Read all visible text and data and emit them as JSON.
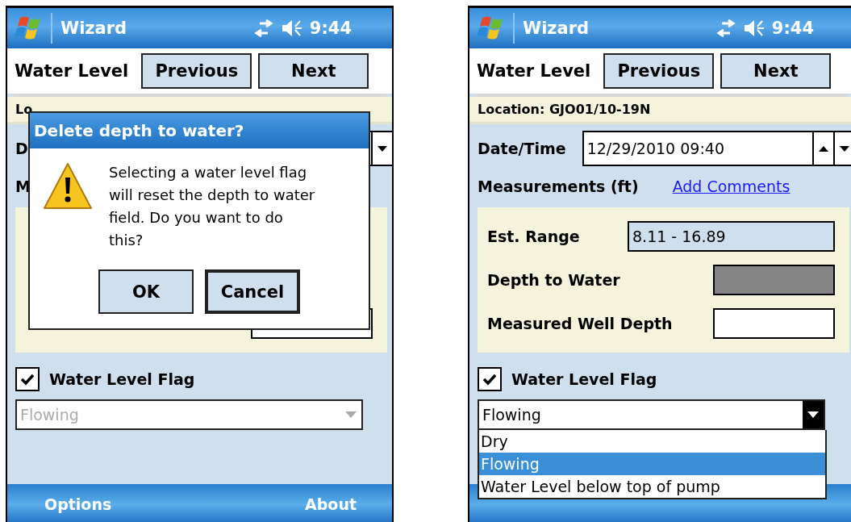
{
  "screens": [
    {
      "title": "Wizard",
      "time": "9:44",
      "heading": "Water Level",
      "buttons": [
        {
          "label": "Previous"
        },
        {
          "label": "Next"
        }
      ],
      "location": "Lo",
      "date": {
        "label": "D",
        "kind": "dropdown"
      },
      "measurements": {
        "label": "M",
        "rows": [
          {
            "kind": "input"
          }
        ]
      },
      "flag": {
        "label": "Water Level Flag",
        "checked": true,
        "value": "Flowing",
        "disabled": true,
        "expanded": false
      },
      "menu": [
        "Options",
        "About"
      ],
      "dialog": {
        "title": "Delete depth to water?",
        "message": "Selecting a water level flag will reset the depth to water field. Do you want to do this?",
        "buttons": [
          {
            "label": "OK",
            "default": false
          },
          {
            "label": "Cancel",
            "default": true
          }
        ]
      }
    },
    {
      "title": "Wizard",
      "time": "9:44",
      "heading": "Water Level",
      "buttons": [
        {
          "label": "Previous"
        },
        {
          "label": "Next"
        }
      ],
      "location": "Location: GJO01/10-19N",
      "date": {
        "label": "Date/Time",
        "value": "12/29/2010 09:40",
        "kind": "updown"
      },
      "measurements": {
        "label": "Measurements (ft)",
        "link": "Add Comments",
        "rows": [
          {
            "label": "Est. Range",
            "value": "8.11 - 16.89",
            "kind": "readonly"
          },
          {
            "label": "Depth to Water",
            "kind": "disabled"
          },
          {
            "label": "Measured Well Depth",
            "kind": "input"
          }
        ]
      },
      "flag": {
        "label": "Water Level Flag",
        "checked": true,
        "value": "Flowing",
        "disabled": false,
        "expanded": true,
        "options": [
          {
            "label": "Dry",
            "selected": false
          },
          {
            "label": "Flowing",
            "selected": true
          },
          {
            "label": "Water Level below top of pump",
            "selected": false
          }
        ]
      }
    }
  ]
}
